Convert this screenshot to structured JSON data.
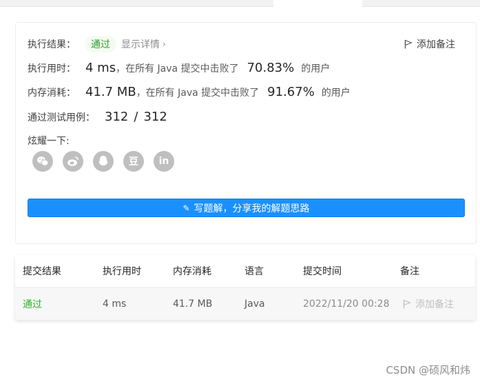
{
  "result": {
    "label": "执行结果：",
    "status": "通过",
    "detail_link": "显示详情",
    "add_note": "添加备注"
  },
  "runtime": {
    "label": "执行用时：",
    "value": "4 ms",
    "middle": "，在所有 Java 提交中击败了",
    "percent": "70.83%",
    "suffix": "的用户"
  },
  "memory": {
    "label": "内存消耗：",
    "value": "41.7 MB",
    "middle": "，在所有 Java 提交中击败了",
    "percent": "91.67%",
    "suffix": "的用户"
  },
  "testcases": {
    "label": "通过测试用例：",
    "passed": "312",
    "sep": "/",
    "total": "312"
  },
  "share": {
    "label": "炫耀一下:",
    "icons": [
      "wechat-icon",
      "weibo-icon",
      "qq-icon",
      "douban-icon",
      "linkedin-icon"
    ],
    "douban_glyph": "豆",
    "linkedin_glyph": "in"
  },
  "write_solution_button": "写题解，分享我的解题思路",
  "table": {
    "headers": [
      "提交结果",
      "执行用时",
      "内存消耗",
      "语言",
      "提交时间",
      "备注"
    ],
    "row": {
      "result": "通过",
      "runtime": "4 ms",
      "memory": "41.7 MB",
      "language": "Java",
      "time": "2022/11/20 00:28",
      "note": "添加备注"
    }
  },
  "watermark": "CSDN @硕风和炜",
  "colors": {
    "accent": "#1a90ff",
    "success": "#2cb32c",
    "icon_gray": "#bfbfbf"
  }
}
